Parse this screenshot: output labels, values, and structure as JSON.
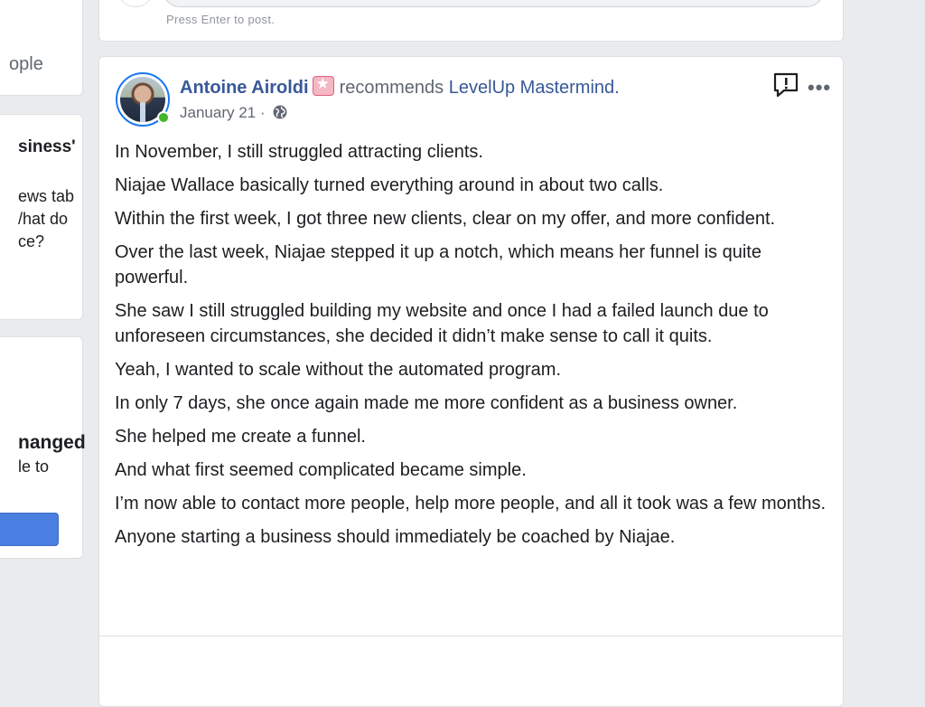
{
  "left_column": {
    "card1_text": "ople",
    "card2_title": "siness'",
    "card2_lines": [
      "ews tab",
      "/hat do",
      "ce?"
    ],
    "card3_title": "nanged",
    "card3_sub": "le to"
  },
  "composer": {
    "hint": "Press Enter to post."
  },
  "post": {
    "author": "Antoine Airoldi",
    "badge_icon": "star-badge-icon",
    "action": "recommends",
    "page": "LevelUp Mastermind.",
    "date": "January 21 ·",
    "privacy_icon": "globe-icon",
    "paragraphs": [
      "In November, I still struggled attracting clients.",
      "Niajae Wallace basically turned everything around in about two calls.",
      "Within the first week, I got three new clients, clear on my offer, and more confident.",
      "Over the last week, Niajae stepped it up a notch, which means her funnel is quite powerful.",
      "She saw I still struggled building my website and once I had a failed launch due to unforeseen circumstances, she decided it didn’t make sense to call it quits.",
      "Yeah, I wanted to scale without the automated program.",
      "In only 7 days, she once again made me more confident as a business owner.",
      "She helped me create a funnel.",
      "And what first seemed complicated became simple.",
      "I’m now able to contact more people, help more people, and all it took was a few months.",
      "Anyone starting a business should immediately be coached by Niajae."
    ]
  },
  "colors": {
    "link": "#385898",
    "online": "#42b72a",
    "button": "#4a7ee0",
    "ring": "#1877f2"
  }
}
